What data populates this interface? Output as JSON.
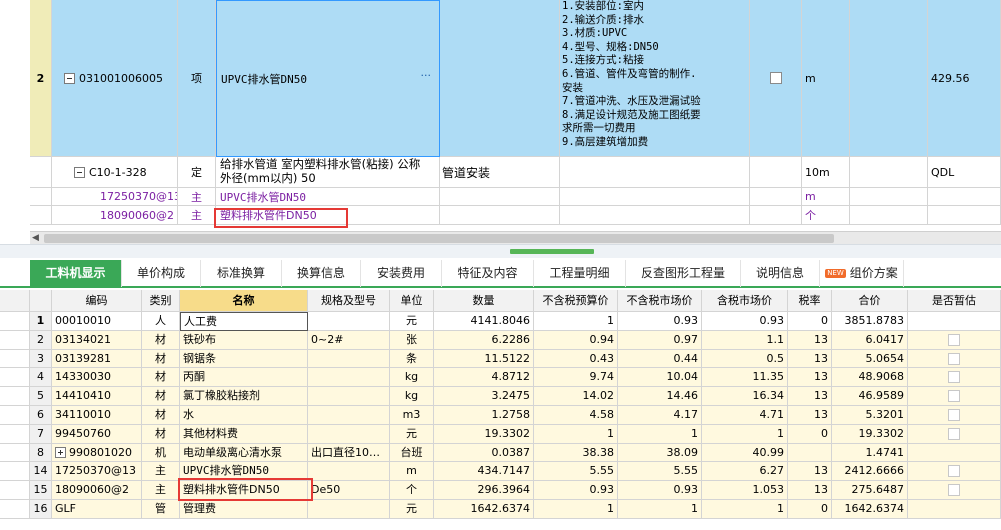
{
  "upper_grid": {
    "row2": {
      "rownum": "2",
      "code": "031001006005",
      "type": "项",
      "name": "UPVC排水管DN50",
      "ellipsis": "···",
      "features": [
        "1.安装部位:室内",
        "2.输送介质:排水",
        "3.材质:UPVC",
        "4.型号、规格:DN50",
        "5.连接方式:粘接",
        "6.管道、管件及弯管的制作.",
        "安装",
        "7.管道冲洗、水压及泄漏试验",
        "8.满足设计规范及施工图纸要",
        "求所需一切费用",
        "9.高层建筑增加费"
      ],
      "unit": "m",
      "value": "429.56"
    },
    "sub_rows": [
      {
        "code": "C10-1-328",
        "type": "定",
        "name_line1": "给排水管道 室内塑料排水管(粘接) 公称",
        "name_line2": "外径(mm以内) 50",
        "category": "管道安装",
        "unit": "10m",
        "expr": "QDL"
      },
      {
        "code": "17250370@13",
        "type": "主",
        "name": "UPVC排水管DN50",
        "unit": "m"
      },
      {
        "code": "18090060@2",
        "type": "主",
        "name": "塑料排水管件DN50",
        "unit": "个"
      }
    ]
  },
  "tabs": [
    {
      "label": "工料机显示",
      "active": true
    },
    {
      "label": "单价构成"
    },
    {
      "label": "标准换算"
    },
    {
      "label": "换算信息"
    },
    {
      "label": "安装费用"
    },
    {
      "label": "特征及内容"
    },
    {
      "label": "工程量明细"
    },
    {
      "label": "反查图形工程量"
    },
    {
      "label": "说明信息"
    },
    {
      "label": "组价方案",
      "badge": "NEW"
    }
  ],
  "bottom_grid": {
    "headers": [
      "编码",
      "类别",
      "名称",
      "规格及型号",
      "单位",
      "数量",
      "不含税预算价",
      "不含税市场价",
      "含税市场价",
      "税率",
      "合价",
      "是否暂估"
    ],
    "rows": [
      {
        "n": "1",
        "code": "00010010",
        "cat": "人",
        "name": "人工费",
        "spec": "",
        "unit": "元",
        "qty": "4141.8046",
        "p1": "1",
        "p2": "0.93",
        "p3": "0.93",
        "tax": "0",
        "total": "3851.8783",
        "check": false
      },
      {
        "n": "2",
        "code": "03134021",
        "cat": "材",
        "name": "铁砂布",
        "spec": "0~2#",
        "unit": "张",
        "qty": "6.2286",
        "p1": "0.94",
        "p2": "0.97",
        "p3": "1.1",
        "tax": "13",
        "total": "6.0417",
        "check": true
      },
      {
        "n": "3",
        "code": "03139281",
        "cat": "材",
        "name": "钢锯条",
        "spec": "",
        "unit": "条",
        "qty": "11.5122",
        "p1": "0.43",
        "p2": "0.44",
        "p3": "0.5",
        "tax": "13",
        "total": "5.0654",
        "check": true
      },
      {
        "n": "4",
        "code": "14330030",
        "cat": "材",
        "name": "丙酮",
        "spec": "",
        "unit": "kg",
        "qty": "4.8712",
        "p1": "9.74",
        "p2": "10.04",
        "p3": "11.35",
        "tax": "13",
        "total": "48.9068",
        "check": true
      },
      {
        "n": "5",
        "code": "14410410",
        "cat": "材",
        "name": "氯丁橡胶粘接剂",
        "spec": "",
        "unit": "kg",
        "qty": "3.2475",
        "p1": "14.02",
        "p2": "14.46",
        "p3": "16.34",
        "tax": "13",
        "total": "46.9589",
        "check": true
      },
      {
        "n": "6",
        "code": "34110010",
        "cat": "材",
        "name": "水",
        "spec": "",
        "unit": "m3",
        "qty": "1.2758",
        "p1": "4.58",
        "p2": "4.17",
        "p3": "4.71",
        "tax": "13",
        "total": "5.3201",
        "check": true
      },
      {
        "n": "7",
        "code": "99450760",
        "cat": "材",
        "name": "其他材料费",
        "spec": "",
        "unit": "元",
        "qty": "19.3302",
        "p1": "1",
        "p2": "1",
        "p3": "1",
        "tax": "0",
        "total": "19.3302",
        "check": true
      },
      {
        "n": "8",
        "code": "990801020",
        "cat": "机",
        "name": "电动单级离心清水泵",
        "spec": "出口直径10…",
        "unit": "台班",
        "qty": "0.0387",
        "p1": "38.38",
        "p2": "38.09",
        "p3": "40.99",
        "tax": "",
        "total": "1.4741",
        "check": false,
        "expand": true
      },
      {
        "n": "14",
        "code": "17250370@13",
        "cat": "主",
        "name": "UPVC排水管DN50",
        "spec": "",
        "unit": "m",
        "qty": "434.7147",
        "p1": "5.55",
        "p2": "5.55",
        "p3": "6.27",
        "tax": "13",
        "total": "2412.6666",
        "check": true
      },
      {
        "n": "15",
        "code": "18090060@2",
        "cat": "主",
        "name": "塑料排水管件DN50",
        "spec": "De50",
        "unit": "个",
        "qty": "296.3964",
        "p1": "0.93",
        "p2": "0.93",
        "p3": "1.053",
        "tax": "13",
        "total": "275.6487",
        "check": true
      },
      {
        "n": "16",
        "code": "GLF",
        "cat": "管",
        "name": "管理费",
        "spec": "",
        "unit": "元",
        "qty": "1642.6374",
        "p1": "1",
        "p2": "1",
        "p3": "1",
        "tax": "0",
        "total": "1642.6374",
        "check": false
      }
    ]
  }
}
